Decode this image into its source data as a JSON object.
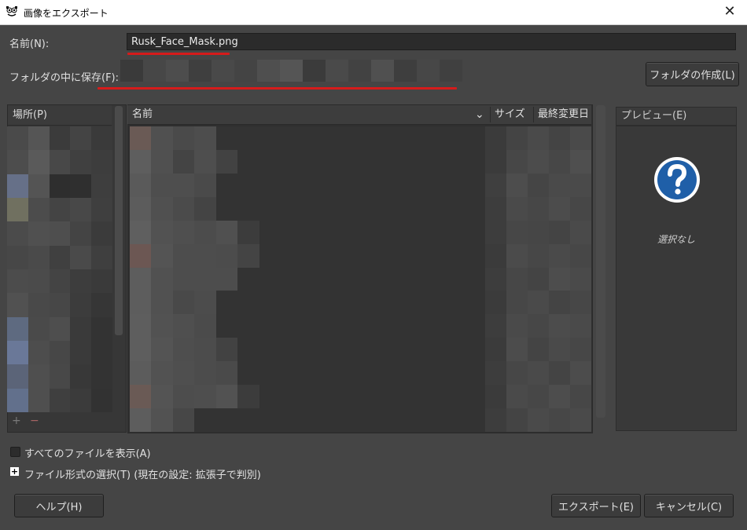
{
  "window": {
    "title": "画像をエクスポート",
    "close_glyph": "✕",
    "app_icon": "gimp-wilber-icon"
  },
  "form": {
    "name_label": "名前(N):",
    "name_value": "Rusk_Face_Mask.png",
    "folder_label": "フォルダの中に保存(F):",
    "create_folder_button": "フォルダの作成(L)"
  },
  "places": {
    "header": "場所(P)",
    "add_glyph": "+",
    "remove_glyph": "−"
  },
  "files": {
    "columns": {
      "name": "名前",
      "size": "サイズ",
      "modified": "最終変更日"
    },
    "sort_glyph": "⌄"
  },
  "preview": {
    "header": "プレビュー(E)",
    "status": "選択なし",
    "icon": "question-icon"
  },
  "options": {
    "show_all_files": "すべてのファイルを表示(A)",
    "file_type": "ファイル形式の選択(T) (現在の設定: 拡張子で判別)"
  },
  "buttons": {
    "help": "ヘルプ(H)",
    "export": "エクスポート(E)",
    "cancel": "キャンセル(C)"
  },
  "colors": {
    "annotation_red": "#d61b1b",
    "dialog_bg": "#454545",
    "help_icon_blue": "#1f5fa8"
  }
}
